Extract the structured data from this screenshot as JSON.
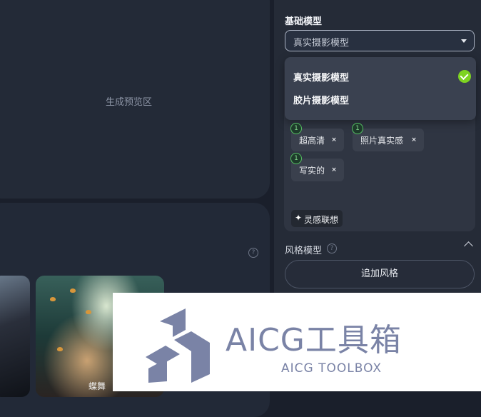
{
  "preview": {
    "label": "生成预览区"
  },
  "gallery": {
    "help_icon": "?",
    "caption": "蝶舞"
  },
  "base_model": {
    "title": "基础模型",
    "selected": "真实摄影模型",
    "options": [
      {
        "label": "真实摄影模型",
        "checked": true
      },
      {
        "label": "胶片摄影模型",
        "checked": false
      }
    ]
  },
  "tags": [
    {
      "label": "超高清",
      "badge": "1",
      "remove": "×"
    },
    {
      "label": "照片真实感",
      "badge": "1",
      "remove": "×"
    },
    {
      "label": "写实的",
      "badge": "1",
      "remove": "×"
    }
  ],
  "inspire": {
    "icon": "✦",
    "label": "灵感联想"
  },
  "style_model": {
    "title": "风格模型",
    "help_icon": "?",
    "add_button": "追加风格"
  },
  "watermark": {
    "title": "AICG工具箱",
    "subtitle": "AICG TOOLBOX"
  },
  "colors": {
    "accent_check": "#7ed321",
    "badge_green": "#55c063"
  }
}
